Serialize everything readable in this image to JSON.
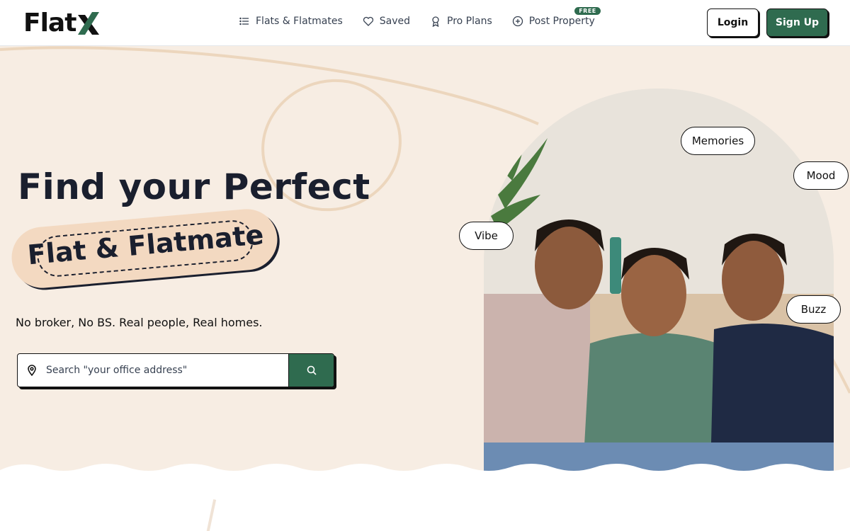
{
  "brand": {
    "name_main": "Flat",
    "name_accent": "X",
    "accent_color": "#2f6b4f",
    "beige": "#f7ede3"
  },
  "nav": {
    "items": [
      {
        "label": "Flats & Flatmates",
        "icon": "list-icon"
      },
      {
        "label": "Saved",
        "icon": "heart-icon"
      },
      {
        "label": "Pro Plans",
        "icon": "award-icon"
      },
      {
        "label": "Post Property",
        "icon": "plus-circle-icon",
        "badge": "FREE"
      }
    ],
    "login_label": "Login",
    "signup_label": "Sign Up"
  },
  "hero": {
    "headline": "Find your Perfect",
    "highlight": "Flat & Flatmate",
    "tagline": "No broker, No BS. Real people, Real homes.",
    "search_placeholder": "Search \"your office address\"",
    "search_icon": "search-icon",
    "location_icon": "map-pin-icon",
    "chips": [
      "Memories",
      "Mood",
      "Vibe",
      "Buzz"
    ]
  }
}
